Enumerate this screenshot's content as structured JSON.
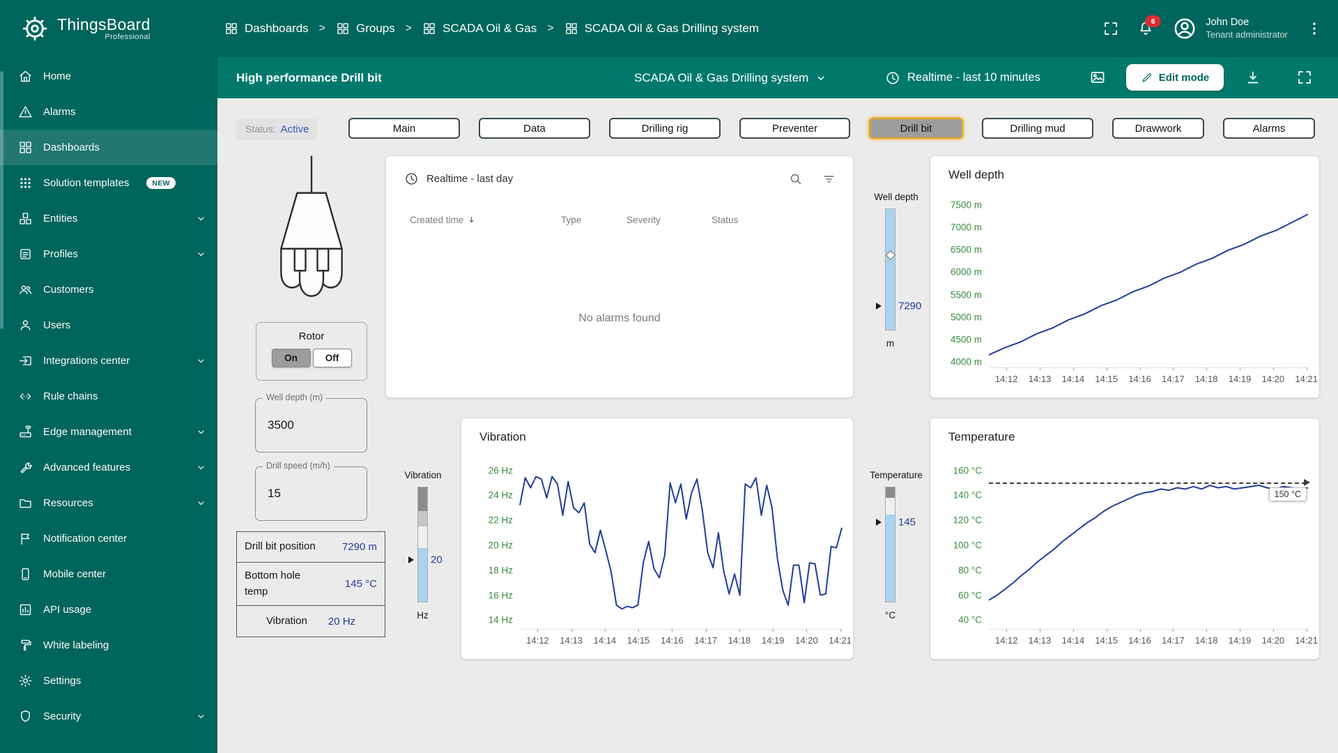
{
  "app": {
    "name": "ThingsBoard",
    "edition": "Professional"
  },
  "colors": {
    "primary": "#00655C",
    "toolbar": "#00796C",
    "line_blue": "#1F3D99",
    "tick_green": "#388E3C",
    "selected_border": "#E7A512",
    "badge_red": "#D3302F",
    "gauge_blue": "#A8D4F0",
    "value_blue": "#1F3D99"
  },
  "header": {
    "breadcrumbs": [
      {
        "label": "Dashboards",
        "icon": "dashboards-icon"
      },
      {
        "label": "Groups",
        "icon": "dashboards-icon"
      },
      {
        "label": "SCADA Oil & Gas",
        "icon": "dashboards-icon"
      },
      {
        "label": "SCADA Oil & Gas Drilling system",
        "icon": "dashboards-icon"
      }
    ],
    "notifications_count": "6",
    "user": {
      "name": "John Doe",
      "role": "Tenant administrator"
    }
  },
  "sidebar": {
    "items": [
      {
        "label": "Home",
        "icon": "home-icon"
      },
      {
        "label": "Alarms",
        "icon": "warning-icon"
      },
      {
        "label": "Dashboards",
        "icon": "dashboards-icon",
        "active": true
      },
      {
        "label": "Solution templates",
        "icon": "apps-icon",
        "badge": "NEW"
      },
      {
        "label": "Entities",
        "icon": "entities-icon",
        "expandable": true
      },
      {
        "label": "Profiles",
        "icon": "profiles-icon",
        "expandable": true
      },
      {
        "label": "Customers",
        "icon": "customers-icon"
      },
      {
        "label": "Users",
        "icon": "user-icon"
      },
      {
        "label": "Integrations center",
        "icon": "integrations-icon",
        "expandable": true
      },
      {
        "label": "Rule chains",
        "icon": "rule-chains-icon"
      },
      {
        "label": "Edge management",
        "icon": "edge-icon",
        "expandable": true
      },
      {
        "label": "Advanced features",
        "icon": "advanced-icon",
        "expandable": true
      },
      {
        "label": "Resources",
        "icon": "resources-icon",
        "expandable": true
      },
      {
        "label": "Notification center",
        "icon": "notification-icon"
      },
      {
        "label": "Mobile center",
        "icon": "mobile-icon"
      },
      {
        "label": "API usage",
        "icon": "api-icon"
      },
      {
        "label": "White labeling",
        "icon": "white-labeling-icon"
      },
      {
        "label": "Settings",
        "icon": "settings-icon"
      },
      {
        "label": "Security",
        "icon": "security-icon",
        "expandable": true
      }
    ]
  },
  "toolbar": {
    "title": "High performance Drill bit",
    "entity": "SCADA Oil & Gas Drilling system",
    "timewindow": "Realtime - last 10 minutes",
    "edit_label": "Edit mode"
  },
  "statusbar": {
    "status_label": "Status:",
    "status_value": "Active",
    "nav_buttons": [
      {
        "label": "Main"
      },
      {
        "label": "Data"
      },
      {
        "label": "Drilling rig"
      },
      {
        "label": "Preventer"
      },
      {
        "label": "Drill bit",
        "selected": true
      },
      {
        "label": "Drilling mud"
      },
      {
        "label": "Drawwork"
      },
      {
        "label": "Alarms"
      }
    ]
  },
  "controls": {
    "rotor": {
      "label": "Rotor",
      "on_label": "On",
      "off_label": "Off",
      "selected": "On"
    },
    "well_depth_input": {
      "label": "Well depth (m)",
      "value": "3500"
    },
    "drill_speed_input": {
      "label": "Drill speed (m/h)",
      "value": "15"
    },
    "info_table": {
      "rows": [
        {
          "label": "Drill bit position",
          "value": "7290 m"
        },
        {
          "label": "Bottom hole temp",
          "value": "145 °C"
        },
        {
          "label": "Vibration",
          "value": "20 Hz"
        }
      ]
    }
  },
  "alarms": {
    "timewindow": "Realtime - last day",
    "columns": [
      "Created time",
      "Type",
      "Severity",
      "Status"
    ],
    "empty_text": "No alarms found"
  },
  "gauges": {
    "well_depth": {
      "label": "Well depth",
      "value": "7290",
      "unit": "m",
      "marker_frac": 0.8,
      "handle_frac": 0.38,
      "segments": [
        {
          "color": "#A8D4F0",
          "frac": 1
        }
      ]
    },
    "vibration": {
      "label": "Vibration",
      "value": "20",
      "unit": "Hz",
      "marker_frac": 0.63,
      "segments": [
        {
          "color": "#8C8C8C",
          "frac": 0.21
        },
        {
          "color": "#C6C6C6",
          "frac": 0.13
        },
        {
          "color": "#EFEFEF",
          "frac": 0.19
        },
        {
          "color": "#A8D4F0",
          "frac": 0.47
        }
      ]
    },
    "temperature": {
      "label": "Temperature",
      "value": "145",
      "unit": "°C",
      "marker_frac": 0.31,
      "segments": [
        {
          "color": "#8C8C8C",
          "frac": 0.09
        },
        {
          "color": "#EFEFEF",
          "frac": 0.15
        },
        {
          "color": "#A8D4F0",
          "frac": 0.76
        }
      ]
    }
  },
  "chart_data": [
    {
      "id": "well-depth",
      "type": "line",
      "title": "Well depth",
      "unit": "m",
      "color": "#1F3D99",
      "ylim": [
        3880,
        7620
      ],
      "yticks": [
        7500,
        7000,
        6500,
        6000,
        5500,
        5000,
        4500,
        4000
      ],
      "xticks": [
        "14:12",
        "14:13",
        "14:14",
        "14:15",
        "14:16",
        "14:17",
        "14:18",
        "14:19",
        "14:20",
        "14:21"
      ],
      "values": [
        4160,
        4320,
        4450,
        4630,
        4760,
        4940,
        5070,
        5250,
        5380,
        5560,
        5690,
        5870,
        6000,
        6180,
        6310,
        6490,
        6620,
        6800,
        6930,
        7110,
        7290
      ]
    },
    {
      "id": "vibration",
      "type": "line",
      "title": "Vibration",
      "unit": "Hz",
      "color": "#1F3D99",
      "ylim": [
        13.3,
        26.7
      ],
      "yticks": [
        26,
        24,
        22,
        20,
        18,
        16,
        14
      ],
      "xticks": [
        "14:12",
        "14:13",
        "14:14",
        "14:15",
        "14:16",
        "14:17",
        "14:18",
        "14:19",
        "14:20",
        "14:21"
      ],
      "values": [
        23.2,
        25.4,
        24.6,
        25.5,
        25.3,
        23.8,
        25.5,
        24.9,
        22.4,
        25.1,
        23.0,
        22.6,
        23.4,
        20.1,
        19.4,
        21.2,
        19.6,
        17.9,
        15.2,
        14.9,
        15.1,
        15.0,
        15.2,
        18.6,
        20.3,
        18.1,
        17.4,
        19.2,
        25.0,
        23.4,
        24.9,
        22.1,
        24.2,
        25.3,
        22.8,
        19.4,
        18.2,
        21.0,
        17.9,
        16.1,
        17.7,
        16.0,
        24.9,
        24.6,
        25.4,
        22.4,
        24.8,
        23.0,
        18.9,
        16.4,
        15.2,
        18.4,
        18.4,
        15.4,
        18.6,
        18.5,
        16.0,
        16.1,
        19.9,
        19.8,
        21.4
      ]
    },
    {
      "id": "temperature",
      "type": "line",
      "title": "Temperature",
      "unit": "°C",
      "color": "#1F3D99",
      "ylim": [
        33,
        167
      ],
      "yticks": [
        160,
        140,
        120,
        100,
        80,
        60,
        40
      ],
      "xticks": [
        "14:12",
        "14:13",
        "14:14",
        "14:15",
        "14:16",
        "14:17",
        "14:18",
        "14:19",
        "14:20",
        "14:21"
      ],
      "threshold": {
        "value": 150,
        "label": "150 °C"
      },
      "values": [
        56,
        60,
        65,
        70,
        76,
        81,
        87,
        92,
        97,
        103,
        108,
        113,
        118,
        122,
        127,
        131,
        134,
        137,
        140,
        142,
        143,
        145,
        144,
        146,
        145,
        147,
        145,
        148,
        146,
        147,
        145,
        146,
        147,
        148,
        146,
        145,
        147,
        146,
        145,
        146
      ]
    }
  ]
}
